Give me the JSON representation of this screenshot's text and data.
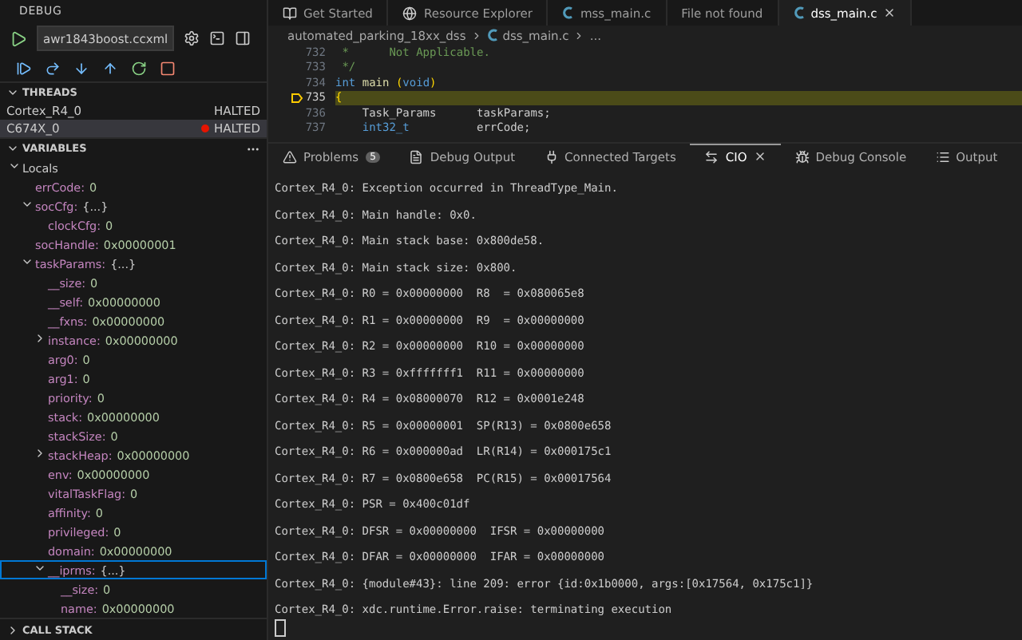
{
  "sidebar": {
    "title": "DEBUG",
    "launch_config": "awr1843boost.ccxml",
    "threads": {
      "title": "THREADS",
      "expanded": true,
      "items": [
        {
          "name": "Cortex_R4_0",
          "status": "HALTED",
          "selected": false,
          "marked": false
        },
        {
          "name": "C674X_0",
          "status": "HALTED",
          "selected": true,
          "marked": true
        }
      ]
    },
    "variables": {
      "title": "VARIABLES",
      "expanded": true,
      "tree": [
        {
          "name": "Locals",
          "expanded": true,
          "selected": false,
          "children": [
            {
              "name": "errCode:",
              "value": "0",
              "selected": false
            },
            {
              "name": "socCfg:",
              "value": "{...}",
              "expanded": true,
              "selected": false,
              "children": [
                {
                  "name": "clockCfg:",
                  "value": "0",
                  "selected": false
                }
              ]
            },
            {
              "name": "socHandle:",
              "value": "0x00000001",
              "selected": false
            },
            {
              "name": "taskParams:",
              "value": "{...}",
              "expanded": true,
              "selected": false,
              "children": [
                {
                  "name": "__size:",
                  "value": "0",
                  "selected": false
                },
                {
                  "name": "__self:",
                  "value": "0x00000000",
                  "selected": false
                },
                {
                  "name": "__fxns:",
                  "value": "0x00000000",
                  "selected": false
                },
                {
                  "name": "instance:",
                  "value": "0x00000000",
                  "expanded": false,
                  "selected": false
                },
                {
                  "name": "arg0:",
                  "value": "0",
                  "selected": false
                },
                {
                  "name": "arg1:",
                  "value": "0",
                  "selected": false
                },
                {
                  "name": "priority:",
                  "value": "0",
                  "selected": false
                },
                {
                  "name": "stack:",
                  "value": "0x00000000",
                  "selected": false
                },
                {
                  "name": "stackSize:",
                  "value": "0",
                  "selected": false
                },
                {
                  "name": "stackHeap:",
                  "value": "0x00000000",
                  "expanded": false,
                  "selected": false
                },
                {
                  "name": "env:",
                  "value": "0x00000000",
                  "selected": false
                },
                {
                  "name": "vitalTaskFlag:",
                  "value": "0",
                  "selected": false
                },
                {
                  "name": "affinity:",
                  "value": "0",
                  "selected": false
                },
                {
                  "name": "privileged:",
                  "value": "0",
                  "selected": false
                },
                {
                  "name": "domain:",
                  "value": "0x00000000",
                  "selected": false
                },
                {
                  "name": "__iprms:",
                  "value": "{...}",
                  "expanded": true,
                  "selected": true,
                  "children": [
                    {
                      "name": "__size:",
                      "value": "0",
                      "selected": false
                    },
                    {
                      "name": "name:",
                      "value": "0x00000000",
                      "selected": false
                    }
                  ]
                }
              ]
            }
          ]
        }
      ]
    },
    "call_stack": {
      "title": "CALL STACK",
      "expanded": false
    }
  },
  "editor_tabs": [
    {
      "label": "Get Started",
      "kind": "welcome",
      "selected": false
    },
    {
      "label": "Resource Explorer",
      "kind": "explorer",
      "selected": false
    },
    {
      "label": "mss_main.c",
      "kind": "source",
      "selected": false
    },
    {
      "label": "File not found",
      "kind": "missing",
      "selected": false
    },
    {
      "label": "dss_main.c",
      "kind": "source",
      "selected": true
    }
  ],
  "breadcrumb": [
    {
      "label": "automated_parking_18xx_dss",
      "kind": "folder"
    },
    {
      "label": "dss_main.c",
      "kind": "source"
    },
    {
      "label": "...",
      "kind": "symbol"
    }
  ],
  "code_lines": [
    {
      "number": "732",
      "current": false,
      "tokens": [
        {
          "kind": "comment",
          "text": " *      Not Applicable."
        }
      ]
    },
    {
      "number": "733",
      "current": false,
      "tokens": [
        {
          "kind": "comment",
          "text": " */"
        }
      ]
    },
    {
      "number": "734",
      "current": false,
      "tokens": [
        {
          "kind": "keyword",
          "text": "int"
        },
        {
          "kind": "function",
          "text": " main"
        },
        {
          "kind": "paren",
          "text": " ("
        },
        {
          "kind": "keyword",
          "text": "void"
        },
        {
          "kind": "paren",
          "text": ")"
        }
      ]
    },
    {
      "number": "735",
      "current": true,
      "tokens": [
        {
          "kind": "paren",
          "text": "{"
        }
      ]
    },
    {
      "number": "736",
      "current": false,
      "tokens": [
        {
          "kind": "plain",
          "text": "    Task_Params      taskParams;"
        }
      ]
    },
    {
      "number": "737",
      "current": false,
      "tokens": [
        {
          "kind": "keyword",
          "text": "    int32_t"
        },
        {
          "kind": "plain",
          "text": "          errCode;"
        }
      ]
    }
  ],
  "panel_tabs": [
    {
      "label": "Problems",
      "kind": "problems",
      "badge": "5",
      "selected": false
    },
    {
      "label": "Debug Output",
      "kind": "debug_output",
      "selected": false
    },
    {
      "label": "Connected Targets",
      "kind": "targets",
      "selected": false
    },
    {
      "label": "CIO",
      "kind": "cio",
      "selected": true
    },
    {
      "label": "Debug Console",
      "kind": "debug_console",
      "selected": false
    },
    {
      "label": "Output",
      "kind": "output",
      "selected": false
    }
  ],
  "console_lines": [
    "Cortex_R4_0: Exception occurred in ThreadType_Main.",
    "Cortex_R4_0: Main handle: 0x0.",
    "Cortex_R4_0: Main stack base: 0x800de58.",
    "Cortex_R4_0: Main stack size: 0x800.",
    "Cortex_R4_0: R0 = 0x00000000  R8  = 0x080065e8",
    "Cortex_R4_0: R1 = 0x00000000  R9  = 0x00000000",
    "Cortex_R4_0: R2 = 0x00000000  R10 = 0x00000000",
    "Cortex_R4_0: R3 = 0xfffffff1  R11 = 0x00000000",
    "Cortex_R4_0: R4 = 0x08000070  R12 = 0x0001e248",
    "Cortex_R4_0: R5 = 0x00000001  SP(R13) = 0x0800e658",
    "Cortex_R4_0: R6 = 0x000000ad  LR(R14) = 0x000175c1",
    "Cortex_R4_0: R7 = 0x0800e658  PC(R15) = 0x00017564",
    "Cortex_R4_0: PSR = 0x400c01df",
    "Cortex_R4_0: DFSR = 0x00000000  IFSR = 0x00000000",
    "Cortex_R4_0: DFAR = 0x00000000  IFAR = 0x00000000",
    "Cortex_R4_0: {module#43}: line 209: error {id:0x1b0000, args:[0x17564, 0x175c1]}",
    "Cortex_R4_0: xdc.runtime.Error.raise: terminating execution"
  ]
}
